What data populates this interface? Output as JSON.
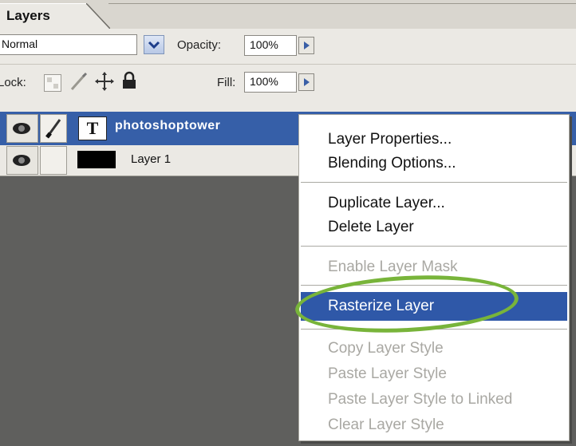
{
  "panel": {
    "tab_label": "Layers",
    "blend_mode": "Normal",
    "opacity_label": "Opacity:",
    "opacity_value": "100%",
    "lock_label": "Lock:",
    "fill_label": "Fill:",
    "fill_value": "100%"
  },
  "layers": [
    {
      "name": "photoshoptower",
      "type_glyph": "T",
      "selected": true
    },
    {
      "name": "Layer 1",
      "selected": false
    }
  ],
  "context_menu": {
    "items": [
      {
        "label": "Layer Properties...",
        "enabled": true
      },
      {
        "label": "Blending Options...",
        "enabled": true
      },
      {
        "label": "Duplicate Layer...",
        "enabled": true
      },
      {
        "label": "Delete Layer",
        "enabled": true
      },
      {
        "label": "Enable Layer Mask",
        "enabled": false
      },
      {
        "label": "Rasterize Layer",
        "enabled": true,
        "highlighted": true
      },
      {
        "label": "Copy Layer Style",
        "enabled": false
      },
      {
        "label": "Paste Layer Style",
        "enabled": false
      },
      {
        "label": "Paste Layer Style to Linked",
        "enabled": false
      },
      {
        "label": "Clear Layer Style",
        "enabled": false
      }
    ]
  },
  "colors": {
    "selection": "#2f58a8",
    "annotation_ring": "#78b43a",
    "panel_bg": "#ebe9e4",
    "canvas_bg": "#5f5f5d"
  },
  "icons": [
    "visibility-eye-icon",
    "brush-link-icon",
    "move-lock-icon",
    "padlock-icon",
    "transparency-lock-icon",
    "dropdown-chevron-icon",
    "arrow-right-icon"
  ]
}
